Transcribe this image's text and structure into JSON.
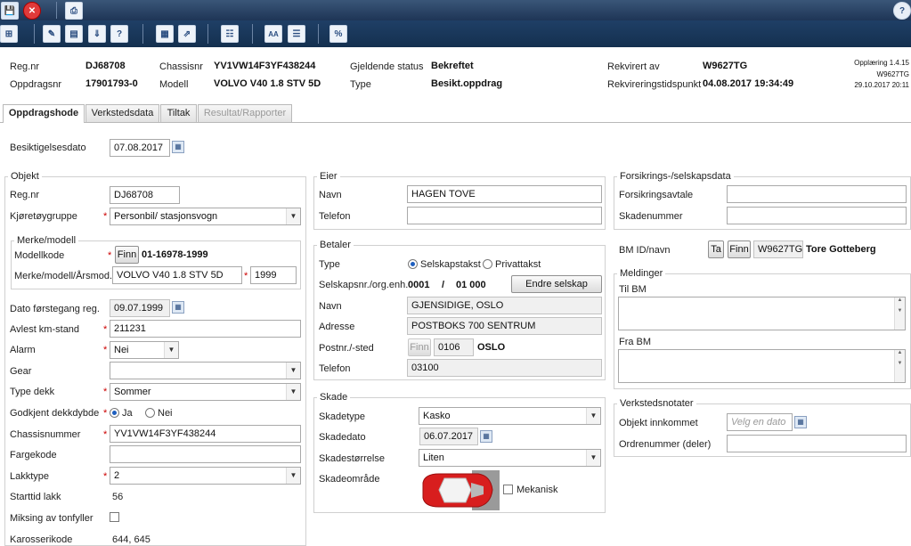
{
  "toolbar": {
    "top_icons": [
      "save-icon",
      "close-icon",
      "print-icon"
    ],
    "icons": [
      "calculator-icon",
      "edit-icon",
      "report-icon",
      "import-icon",
      "help-doc-icon",
      "form-icon",
      "export-icon",
      "document-icon",
      "text-size-icon",
      "document-edit-icon",
      "percent-icon"
    ],
    "help": "?"
  },
  "header": {
    "regnr_label": "Reg.nr",
    "regnr": "DJ68708",
    "oppdragsnr_label": "Oppdragsnr",
    "oppdragsnr": "17901793-0",
    "chassisnr_label": "Chassisnr",
    "chassisnr": "YV1VW14F3YF438244",
    "modell_label": "Modell",
    "modell": "VOLVO V40 1.8 STV 5D",
    "status_label": "Gjeldende status",
    "status": "Bekreftet",
    "type_label": "Type",
    "type": "Besikt.oppdrag",
    "rekvirert_label": "Rekvirert av",
    "rekvirert": "W9627TG",
    "rekv_tid_label": "Rekvireringstidspunkt",
    "rekv_tid": "04.08.2017 19:34:49",
    "info1": "Opplæring 1.4.15",
    "info2": "W9627TG",
    "info3": "29.10.2017 20:11"
  },
  "tabs": [
    "Oppdragshode",
    "Verkstedsdata",
    "Tiltak",
    "Resultat/Rapporter"
  ],
  "besiktigelse": {
    "label": "Besiktigelsesdato",
    "value": "07.08.2017"
  },
  "objekt": {
    "title": "Objekt",
    "regnr_label": "Reg.nr",
    "regnr": "DJ68708",
    "kjoretoy_label": "Kjøretøygruppe",
    "kjoretoy": "Personbil/ stasjonsvogn",
    "merke_title": "Merke/modell",
    "modellkode_label": "Modellkode",
    "finn": "Finn",
    "modellkode": "01-16978-1999",
    "merke_label": "Merke/modell/Årsmod.",
    "merke": "VOLVO V40 1.8 STV 5D",
    "aar": "1999",
    "dato_label": "Dato førstegang reg.",
    "dato": "09.07.1999",
    "km_label": "Avlest km-stand",
    "km": "211231",
    "alarm_label": "Alarm",
    "alarm": "Nei",
    "gear_label": "Gear",
    "gear": "",
    "dekk_label": "Type dekk",
    "dekk": "Sommer",
    "dekkdybde_label": "Godkjent dekkdybde",
    "ja": "Ja",
    "nei": "Nei",
    "chassis_label": "Chassisnummer",
    "chassis": "YV1VW14F3YF438244",
    "farge_label": "Fargekode",
    "farge": "",
    "lakk_label": "Lakktype",
    "lakk": "2",
    "start_label": "Starttid lakk",
    "start": "56",
    "miks_label": "Miksing av tonfyller",
    "karosseri_label": "Karosserikode",
    "karosseri": "644, 645"
  },
  "eier": {
    "title": "Eier",
    "navn_label": "Navn",
    "navn": "HAGEN TOVE",
    "tlf_label": "Telefon",
    "tlf": ""
  },
  "betaler": {
    "title": "Betaler",
    "type_label": "Type",
    "selskap": "Selskapstakst",
    "privat": "Privattakst",
    "orgnr_label": "Selskapsnr./org.enh.",
    "orgnr1": "0001",
    "slash": "/",
    "orgnr2": "01 000",
    "endre": "Endre selskap",
    "navn_label": "Navn",
    "navn": "GJENSIDIGE, OSLO",
    "adr_label": "Adresse",
    "adr": "POSTBOKS 700 SENTRUM",
    "post_label": "Postnr./-sted",
    "finn": "Finn",
    "postnr": "0106",
    "sted": "OSLO",
    "tlf_label": "Telefon",
    "tlf": "03100"
  },
  "skade": {
    "title": "Skade",
    "type_label": "Skadetype",
    "type": "Kasko",
    "dato_label": "Skadedato",
    "dato": "06.07.2017",
    "storrelse_label": "Skadestørrelse",
    "storrelse": "Liten",
    "omrade_label": "Skadeområde",
    "mekanisk": "Mekanisk"
  },
  "forsikring": {
    "title": "Forsikrings-/selskapsdata",
    "avtale_label": "Forsikringsavtale",
    "avtale": "",
    "skade_label": "Skadenummer",
    "skade": ""
  },
  "bm": {
    "label": "BM ID/navn",
    "ta": "Ta",
    "finn": "Finn",
    "id": "W9627TG",
    "navn": "Tore Gotteberg"
  },
  "meldinger": {
    "title": "Meldinger",
    "til": "Til BM",
    "fra": "Fra BM"
  },
  "verksted": {
    "title": "Verkstedsnotater",
    "innkommet_label": "Objekt innkommet",
    "innkommet_ph": "Velg en dato",
    "ordre_label": "Ordrenummer (deler)",
    "ordre": ""
  }
}
